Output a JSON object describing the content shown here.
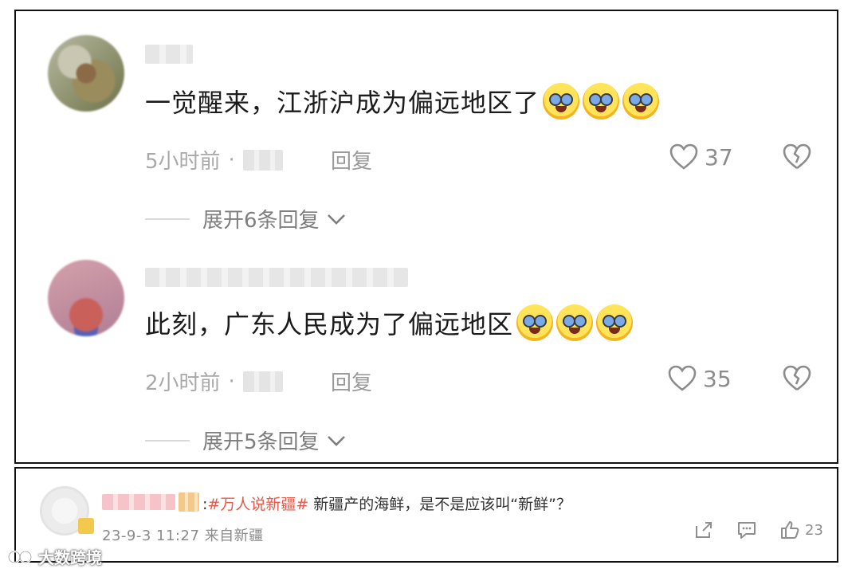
{
  "comments": [
    {
      "text": "一觉醒来，江浙沪成为偏远地区了",
      "emoji_name": "crying-laughing-emoji",
      "time": "5小时前",
      "separator": "·",
      "reply_label": "回复",
      "likes": "37",
      "expand_label": "展开6条回复"
    },
    {
      "text": "此刻，广东人民成为了偏远地区",
      "emoji_name": "crying-laughing-emoji",
      "time": "2小时前",
      "separator": "·",
      "reply_label": "回复",
      "likes": "35",
      "expand_label": "展开5条回复"
    }
  ],
  "weibo": {
    "colon": ":",
    "hashtag": "#万人说新疆#",
    "text": " 新疆产的海鲜，是不是应该叫“新鲜”？",
    "meta": "23-9-3 11:27  来自新疆",
    "like_count": "23",
    "icons": [
      "share-icon",
      "comment-icon",
      "thumbs-up-icon"
    ]
  },
  "watermark": {
    "text": "大数跨境"
  },
  "colors": {
    "hashtag": "#e8594b",
    "meta_gray": "#a9a9a9",
    "text_dark": "#1b1b1b"
  }
}
